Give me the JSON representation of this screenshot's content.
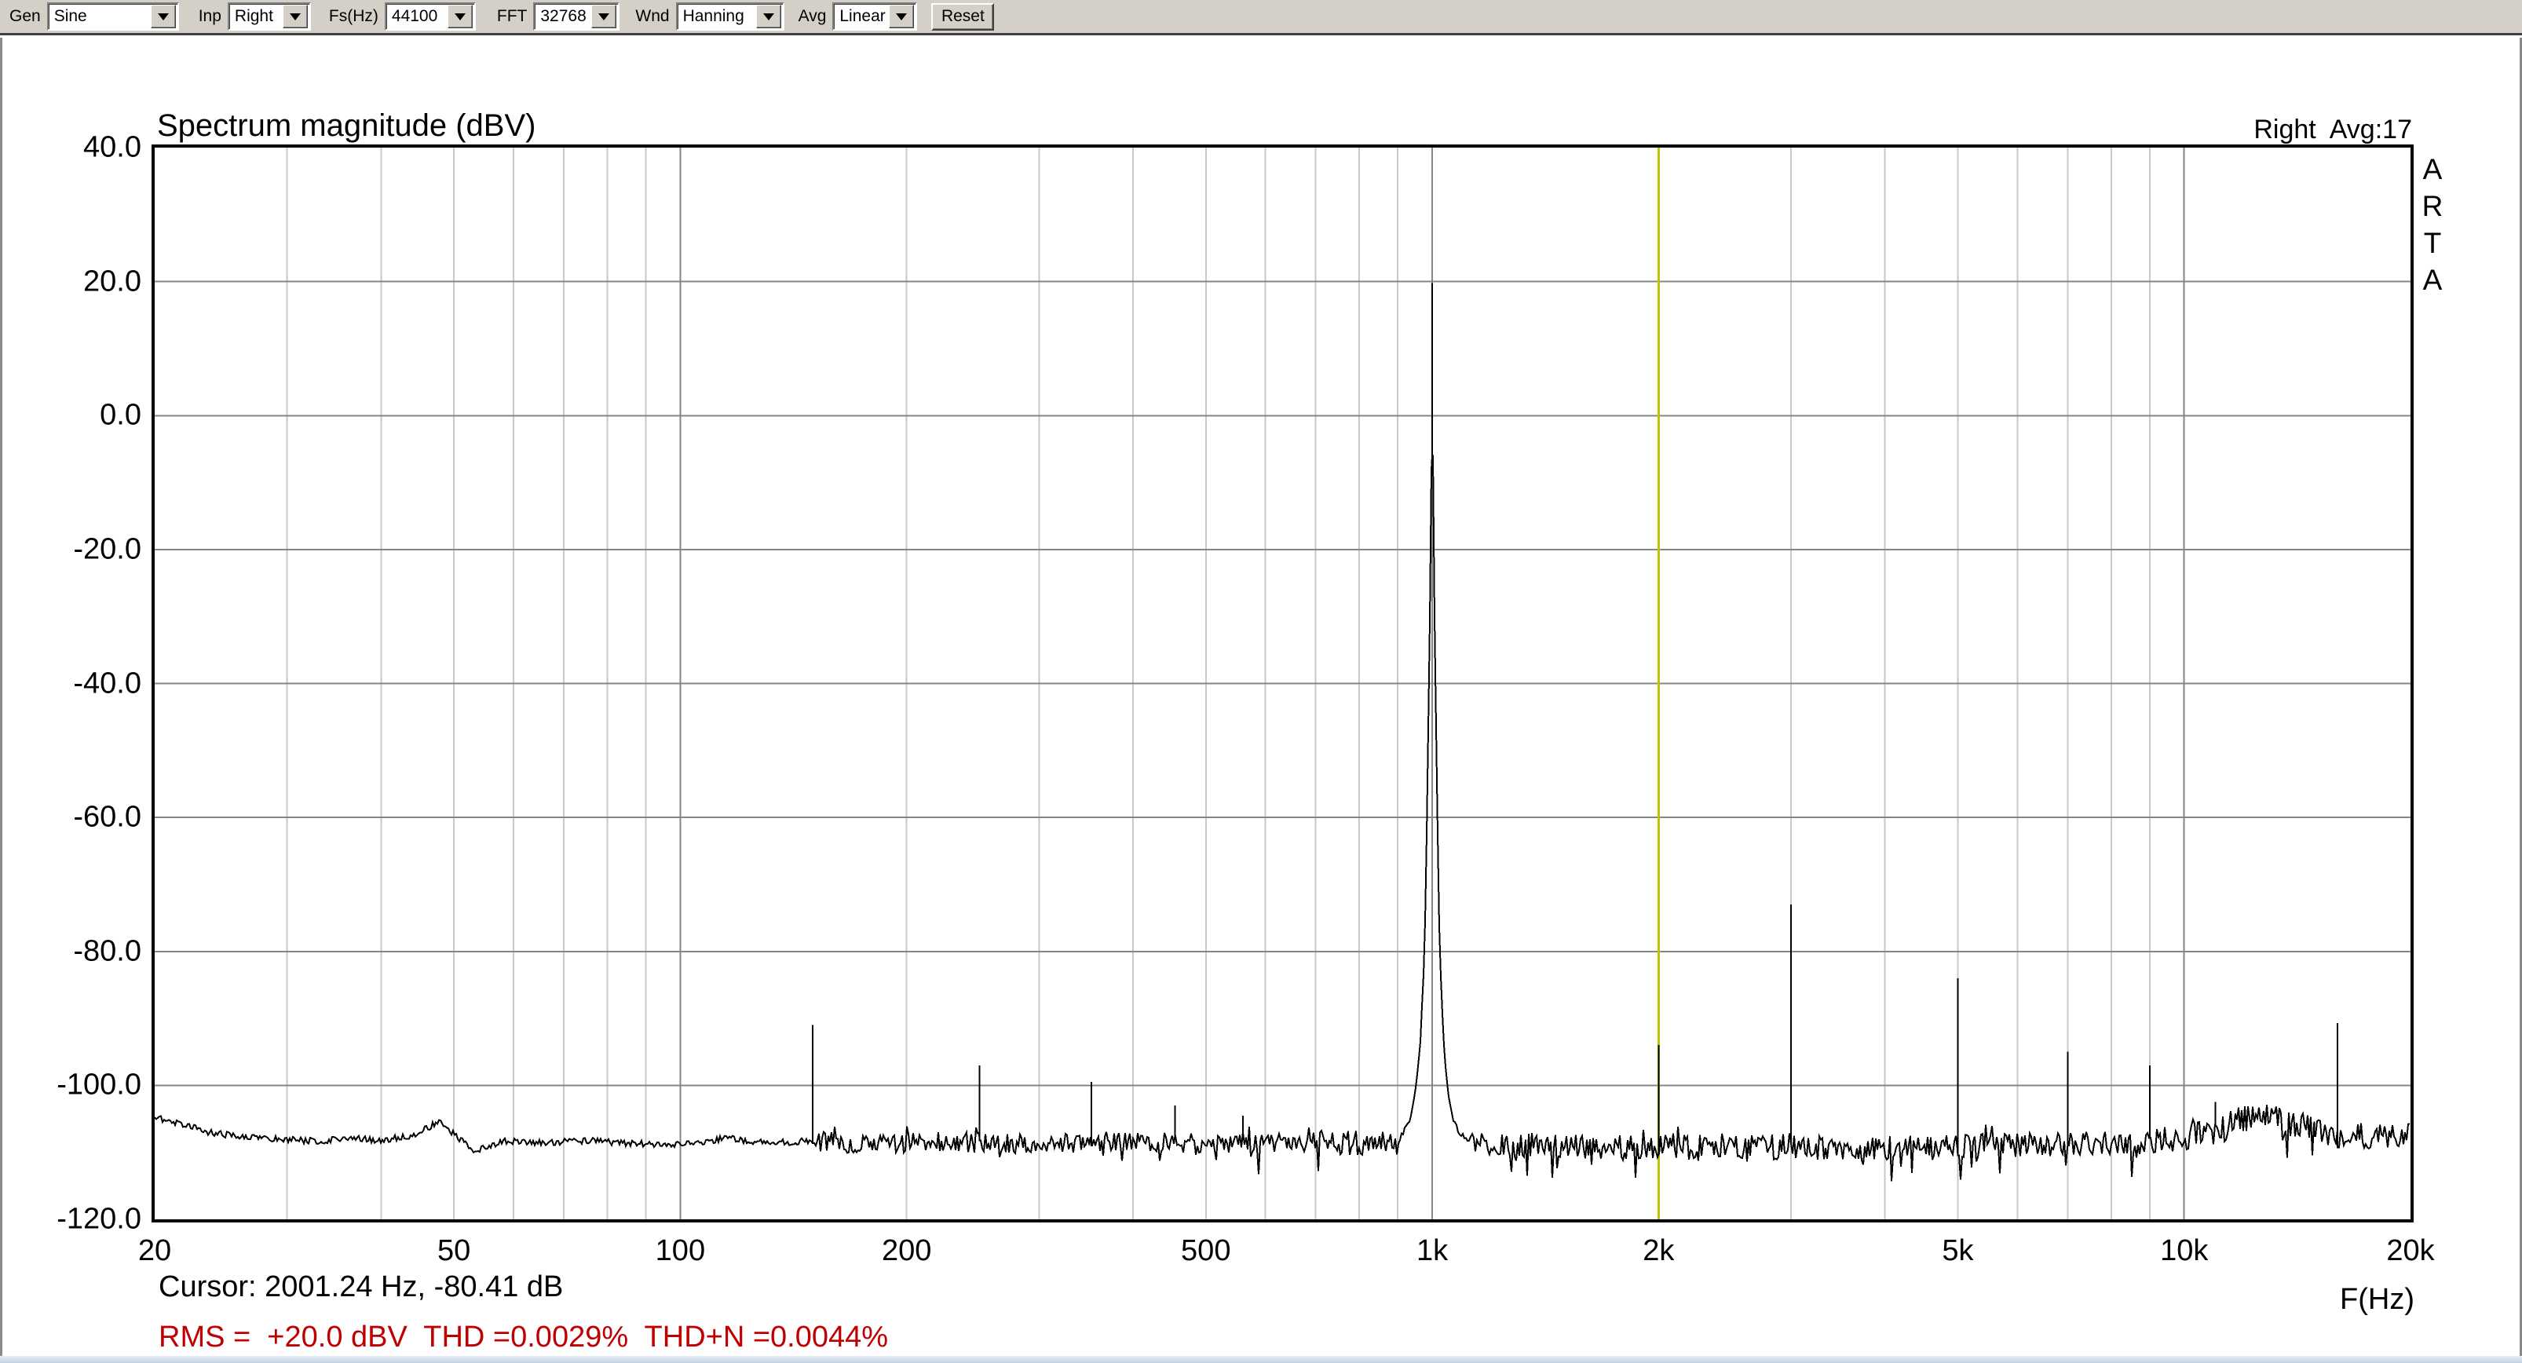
{
  "toolbar": {
    "gen_label": "Gen",
    "gen_value": "Sine",
    "inp_label": "Inp",
    "inp_value": "Right",
    "fs_label": "Fs(Hz)",
    "fs_value": "44100",
    "fft_label": "FFT",
    "fft_value": "32768",
    "wnd_label": "Wnd",
    "wnd_value": "Hanning",
    "avg_label": "Avg",
    "avg_value": "Linear",
    "reset_label": "Reset"
  },
  "header": {
    "channel_avg": "Right  Avg:17"
  },
  "watermark": {
    "letters": [
      "A",
      "R",
      "T",
      "A"
    ]
  },
  "status": {
    "cursor_text": "Cursor: 2001.24 Hz, -80.41 dB",
    "rms_text": "RMS =  +20.0 dBV  THD =0.0029%  THD+N =0.0044%"
  },
  "chart_data": {
    "type": "line",
    "title": "Spectrum magnitude (dBV)",
    "x_scale": "log",
    "xlim": [
      20,
      20000
    ],
    "ylim": [
      -120,
      40
    ],
    "x_unit": "F(Hz)",
    "x_ticks": [
      {
        "f": 20,
        "label": "20"
      },
      {
        "f": 50,
        "label": "50"
      },
      {
        "f": 100,
        "label": "100"
      },
      {
        "f": 200,
        "label": "200"
      },
      {
        "f": 500,
        "label": "500"
      },
      {
        "f": 1000,
        "label": "1k"
      },
      {
        "f": 2000,
        "label": "2k"
      },
      {
        "f": 5000,
        "label": "5k"
      },
      {
        "f": 10000,
        "label": "10k"
      },
      {
        "f": 20000,
        "label": "20k"
      }
    ],
    "y_ticks": [
      {
        "db": 40,
        "label": "40.0"
      },
      {
        "db": 20,
        "label": "20.0"
      },
      {
        "db": 0,
        "label": "0.0"
      },
      {
        "db": -20,
        "label": "-20.0"
      },
      {
        "db": -40,
        "label": "-40.0"
      },
      {
        "db": -60,
        "label": "-60.0"
      },
      {
        "db": -80,
        "label": "-80.0"
      },
      {
        "db": -100,
        "label": "-100.0"
      },
      {
        "db": -120,
        "label": "-120.0"
      }
    ],
    "grid": {
      "minor_f": [
        30,
        40,
        50,
        60,
        70,
        80,
        90,
        200,
        300,
        400,
        500,
        600,
        700,
        800,
        900,
        2000,
        3000,
        4000,
        5000,
        6000,
        7000,
        8000,
        9000
      ],
      "major_f": [
        100,
        1000,
        10000
      ],
      "y_lines_db": [
        20,
        0,
        -20,
        -40,
        -60,
        -80,
        -100
      ]
    },
    "colors": {
      "grid_major": "#858585",
      "grid_minor": "#c9c9c9",
      "border": "#000000",
      "trace": "#000000",
      "cursor_line": "#c2c200",
      "readout_red": "#c00000"
    },
    "fundamental": {
      "freq": 1000,
      "peak_db": 19.8
    },
    "fundamental_skirt": [
      [
        900,
        -108.5
      ],
      [
        915,
        -107
      ],
      [
        935,
        -105
      ],
      [
        953,
        -100
      ],
      [
        965,
        -93
      ],
      [
        977,
        -80
      ],
      [
        984,
        -60
      ],
      [
        990,
        -40
      ],
      [
        996,
        -20
      ],
      [
        998,
        -4
      ],
      [
        1002,
        -4
      ],
      [
        1004,
        -20
      ],
      [
        1010,
        -40
      ],
      [
        1016,
        -60
      ],
      [
        1023,
        -80
      ],
      [
        1035,
        -93
      ],
      [
        1047,
        -100
      ],
      [
        1062,
        -104.5
      ],
      [
        1085,
        -107
      ],
      [
        1120,
        -108.5
      ]
    ],
    "harmonics": [
      {
        "f": 2001,
        "db": -94
      },
      {
        "f": 3000,
        "db": -73
      },
      {
        "f": 5000,
        "db": -84
      },
      {
        "f": 7000,
        "db": -95
      },
      {
        "f": 9000,
        "db": -97
      },
      {
        "f": 11000,
        "db": -102.5
      },
      {
        "f": 14900,
        "db": -105.4
      },
      {
        "f": 16000,
        "db": -90.7
      }
    ],
    "spurs": [
      {
        "f": 150,
        "db": -91
      },
      {
        "f": 250,
        "db": -97
      },
      {
        "f": 352,
        "db": -99.5
      },
      {
        "f": 455,
        "db": -103
      },
      {
        "f": 560,
        "db": -104.5
      }
    ],
    "noise_floor": [
      [
        20,
        -104.8
      ],
      [
        24,
        -107.2
      ],
      [
        28,
        -107.8
      ],
      [
        33,
        -108.4
      ],
      [
        36,
        -107.8
      ],
      [
        40,
        -108.2
      ],
      [
        44,
        -107.5
      ],
      [
        48,
        -105.4
      ],
      [
        53,
        -109.8
      ],
      [
        58,
        -108.3
      ],
      [
        65,
        -108.6
      ],
      [
        75,
        -108.2
      ],
      [
        85,
        -108.6
      ],
      [
        100,
        -108.9
      ],
      [
        115,
        -107.9
      ],
      [
        130,
        -108.6
      ],
      [
        150,
        -108.3
      ],
      [
        180,
        -108.9
      ],
      [
        220,
        -108.4
      ],
      [
        300,
        -108.8
      ],
      [
        400,
        -108.3
      ],
      [
        500,
        -108.8
      ],
      [
        600,
        -108.4
      ],
      [
        700,
        -108.6
      ],
      [
        900,
        -108.5
      ],
      [
        1120,
        -108.6
      ],
      [
        1500,
        -109.3
      ],
      [
        2500,
        -109.2
      ],
      [
        4000,
        -109.4
      ],
      [
        6000,
        -109.0
      ],
      [
        8000,
        -108.8
      ],
      [
        10000,
        -107.8
      ],
      [
        11000,
        -106.6
      ],
      [
        12000,
        -104.9
      ],
      [
        12800,
        -104.6
      ],
      [
        13500,
        -105.4
      ],
      [
        14500,
        -106.4
      ],
      [
        16000,
        -107.4
      ],
      [
        18000,
        -107.6
      ],
      [
        20000,
        -107.0
      ]
    ],
    "noise_jitter": {
      "smooth_below_hz": 150,
      "smooth_amp": 0.5,
      "mid_amp": 1.5,
      "dense_amp": 1.9,
      "hump_amp": 2.2
    },
    "cursor": {
      "freq": 2001.24,
      "db": -80.41
    }
  }
}
